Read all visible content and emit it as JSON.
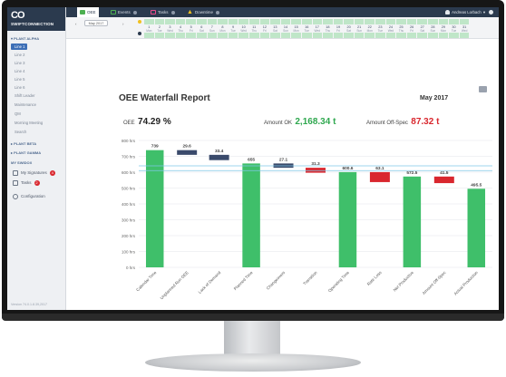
{
  "app": {
    "brand": "SWIFTCONNECTION",
    "brand_logo": "CO"
  },
  "tabs": [
    {
      "label": "OEE",
      "icon": "chart-icon",
      "color": "#4caf50"
    },
    {
      "label": "Events",
      "icon": "events-icon",
      "color": "#4caf50"
    },
    {
      "label": "Tasks",
      "icon": "tasks-icon",
      "color": "#e84a8a"
    },
    {
      "label": "Downtime",
      "icon": "warning-icon",
      "color": "#f0c020"
    }
  ],
  "user": {
    "name": "Andreas Lorbach"
  },
  "sidebar": {
    "section_top": "PLANT ALPHA",
    "lines": [
      "Line 1",
      "Line 2",
      "Line 3",
      "Line 4",
      "Line 5",
      "Line 6"
    ],
    "subitems": [
      "Shift Leader",
      "Maintenance",
      "QM",
      "Morning Meeting",
      "Search"
    ],
    "section_beta": "PLANT BETA",
    "section_gamma": "PLANT GAMMA",
    "section_my": "MY SWIDOX",
    "my_items": [
      {
        "label": "My Signatures",
        "badge": "4"
      },
      {
        "label": "Tasks",
        "badge": "2"
      }
    ],
    "configuration": "Configuration",
    "footer": "Version 74.0.1.8.39,2017"
  },
  "datebar": {
    "month": "May 2017",
    "days": [
      {
        "n": "1",
        "d": "Mon"
      },
      {
        "n": "2",
        "d": "Tue"
      },
      {
        "n": "3",
        "d": "Wed"
      },
      {
        "n": "4",
        "d": "Thu"
      },
      {
        "n": "5",
        "d": "Fri"
      },
      {
        "n": "6",
        "d": "Sat"
      },
      {
        "n": "7",
        "d": "Sun"
      },
      {
        "n": "8",
        "d": "Mon"
      },
      {
        "n": "9",
        "d": "Tue"
      },
      {
        "n": "10",
        "d": "Wed"
      },
      {
        "n": "11",
        "d": "Thu"
      },
      {
        "n": "12",
        "d": "Fri"
      },
      {
        "n": "13",
        "d": "Sat"
      },
      {
        "n": "14",
        "d": "Sun"
      },
      {
        "n": "15",
        "d": "Mon"
      },
      {
        "n": "16",
        "d": "Tue"
      },
      {
        "n": "17",
        "d": "Wed"
      },
      {
        "n": "18",
        "d": "Thu"
      },
      {
        "n": "19",
        "d": "Fri"
      },
      {
        "n": "20",
        "d": "Sat"
      },
      {
        "n": "21",
        "d": "Sun"
      },
      {
        "n": "22",
        "d": "Mon"
      },
      {
        "n": "23",
        "d": "Tue"
      },
      {
        "n": "24",
        "d": "Wed"
      },
      {
        "n": "25",
        "d": "Thu"
      },
      {
        "n": "26",
        "d": "Fri"
      },
      {
        "n": "27",
        "d": "Sat"
      },
      {
        "n": "28",
        "d": "Sun"
      },
      {
        "n": "29",
        "d": "Mon"
      },
      {
        "n": "30",
        "d": "Tue"
      },
      {
        "n": "31",
        "d": "Wed"
      }
    ]
  },
  "report": {
    "title": "OEE Waterfall Report",
    "month": "May 2017",
    "oee_label": "OEE",
    "oee_value": "74.29 %",
    "amount_ok_label": "Amount OK",
    "amount_ok_value": "2,168.34 t",
    "amount_offspec_label": "Amount Off-Spec",
    "amount_offspec_value": "87.32 t"
  },
  "chart_data": {
    "type": "bar",
    "categories": [
      "Calendar Time",
      "Unplanned Run OEE",
      "Lack of Demand",
      "Planned Time",
      "Changeovers",
      "Transition",
      "Operating Time",
      "Rate Loss",
      "Net Productive",
      "Amount Off-Spec",
      "Actual Production"
    ],
    "values": [
      739,
      29.6,
      33.4,
      655,
      27.1,
      31.3,
      600.6,
      63.1,
      572.5,
      41.5,
      495.5
    ],
    "labels": [
      "739",
      "29.6",
      "33.4",
      "655",
      "27.1",
      "31.3",
      "600.6",
      "63.1",
      "572.5",
      "41.5",
      "495.5"
    ],
    "kinds": [
      "total",
      "loss-blue",
      "loss-blue",
      "total",
      "loss-blue",
      "loss-red",
      "total",
      "loss-red",
      "total",
      "loss-red",
      "total"
    ],
    "ylabel_unit": "hrs",
    "yticks": [
      0,
      100,
      200,
      300,
      400,
      500,
      600,
      700,
      800
    ],
    "ytick_labels": [
      "0 hrs",
      "100 hrs",
      "200 hrs",
      "300 hrs",
      "400 hrs",
      "500 hrs",
      "600 hrs",
      "700 hrs",
      "800 hrs"
    ],
    "ylim": [
      0,
      800
    ],
    "reference_lines": [
      610,
      640
    ],
    "colors": {
      "total": "#3fbf6a",
      "loss-blue": "#3a4a6b",
      "loss-red": "#d9272e",
      "ref": "#7fc8e8",
      "grid": "#e3e6ea"
    }
  }
}
